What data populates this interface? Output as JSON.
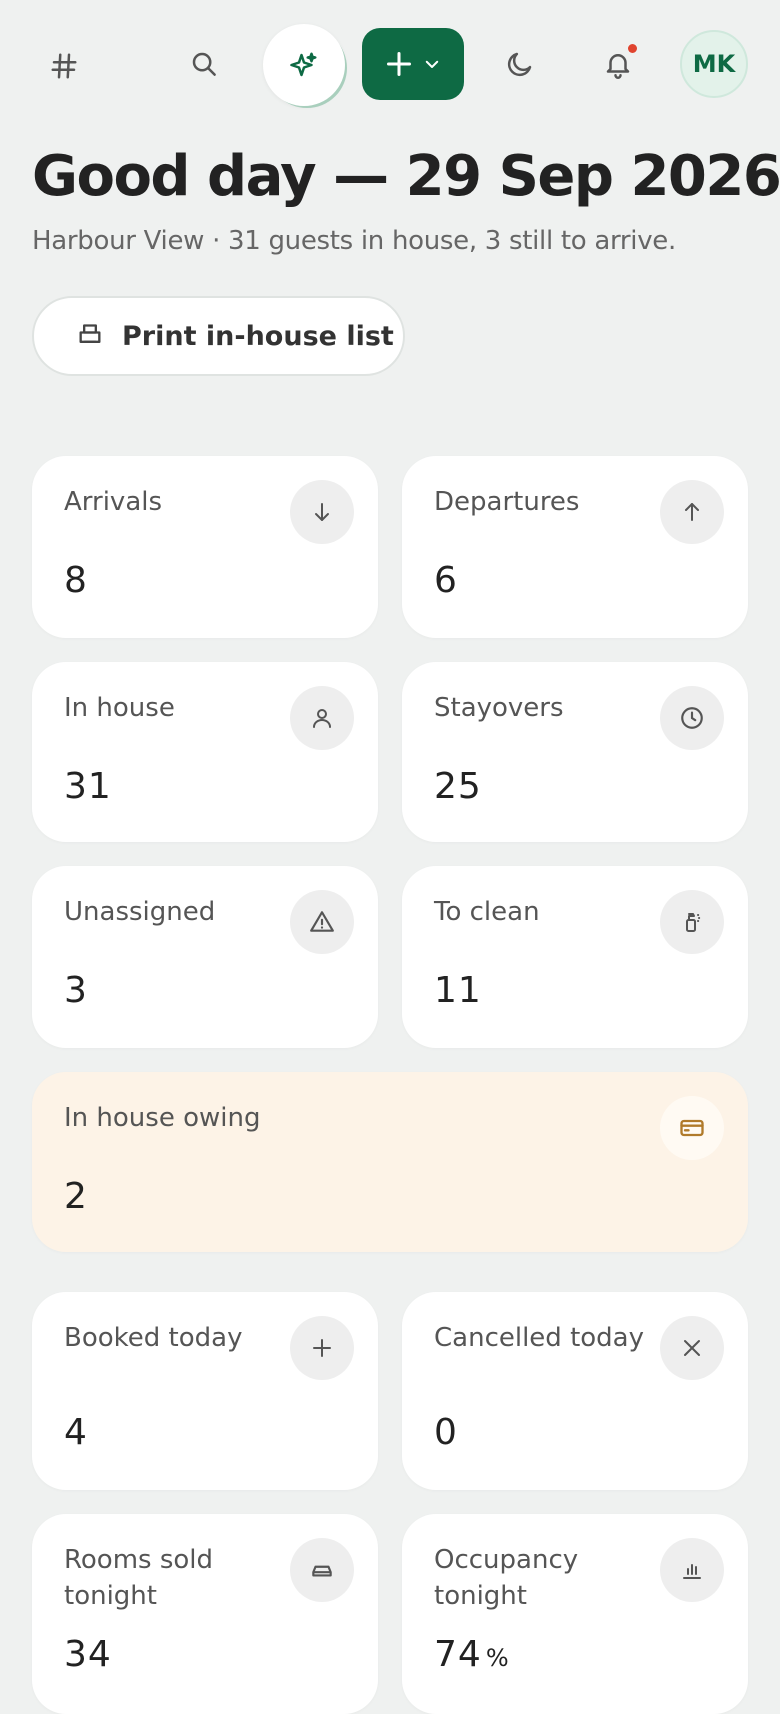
{
  "topbar": {
    "avatar_initials": "MK",
    "icons": [
      "hash-icon",
      "search-icon",
      "sparkle-icon",
      "plus-icon",
      "chevron-down-icon",
      "moon-icon",
      "bell-icon"
    ],
    "accent": "#0e6a44",
    "notification_dot": "#e0442f"
  },
  "header": {
    "title": "Good day — 29 Sep 2026",
    "subtitle": "Harbour View · 31 guests in house, 3 still to arrive."
  },
  "actions": {
    "print_label": "Print in-house list"
  },
  "stats": {
    "arrivals": {
      "label": "Arrivals",
      "value": "8"
    },
    "departures": {
      "label": "Departures",
      "value": "6"
    },
    "in_house": {
      "label": "In house",
      "value": "31"
    },
    "stayovers": {
      "label": "Stayovers",
      "value": "25"
    },
    "unassigned": {
      "label": "Unassigned",
      "value": "3"
    },
    "to_clean": {
      "label": "To clean",
      "value": "11"
    },
    "in_house_owing": {
      "label": "In house owing",
      "value": "2"
    },
    "booked_today": {
      "label": "Booked today",
      "value": "4"
    },
    "cancelled_today": {
      "label": "Cancelled today",
      "value": "0"
    },
    "rooms_sold": {
      "label": "Rooms sold tonight",
      "value": "34"
    },
    "occupancy": {
      "label": "Occupancy tonight",
      "value": "74",
      "unit": "%"
    }
  }
}
